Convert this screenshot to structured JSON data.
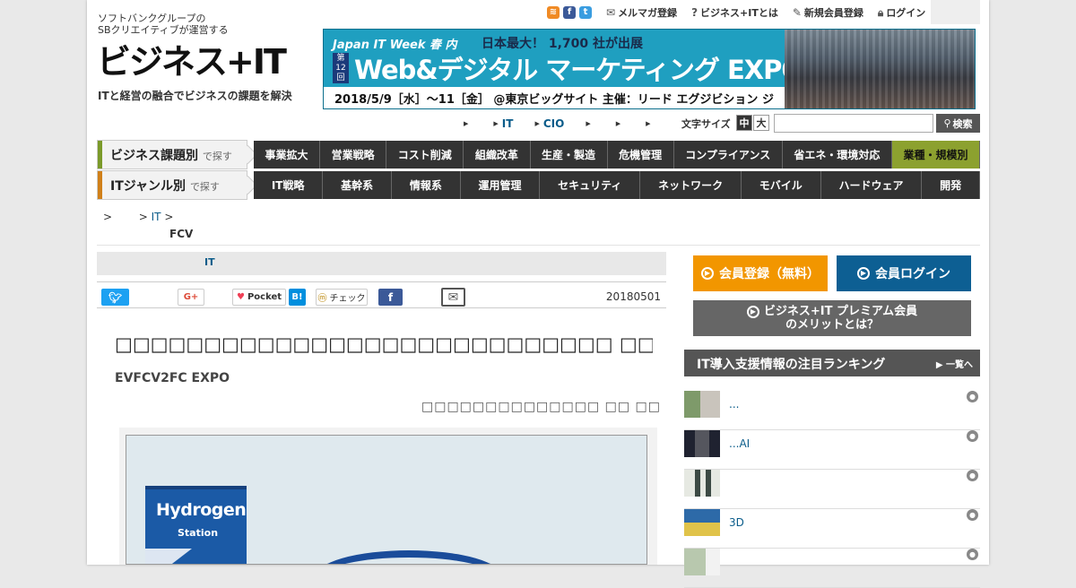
{
  "header": {
    "operator_line1": "ソフトバンクグループの",
    "operator_line2": "SBクリエイティブが運営する",
    "logo": "ビジネス+IT",
    "tagline": "ITと経営の融合でビジネスの課題を解決",
    "links": [
      {
        "label": "メルマガ登録",
        "icon": "envelope-icon"
      },
      {
        "label": "ビジネス+ITとは",
        "icon": "question-icon"
      },
      {
        "label": "新規会員登録",
        "icon": "pencil-icon"
      },
      {
        "label": "ログイン",
        "icon": "lock-icon"
      }
    ],
    "social_icons": [
      "rss-icon",
      "facebook-icon",
      "twitter-icon"
    ]
  },
  "banner": {
    "event_brand": "Japan IT Week 春 内",
    "headline": "日本最大！ 1,700 社が出展",
    "edition_line1": "第",
    "edition_line2": "12",
    "edition_line3": "回",
    "title": "Web&デジタル マーケティング EXPO 春",
    "info": "2018/5/9［水］～11［金］ @東京ビッグサイト 主催：リード エグジビション ジャパン（株）"
  },
  "util": {
    "items": [
      "",
      "IT",
      "CIO",
      "",
      "",
      ""
    ],
    "fontsize_label": "文字サイズ",
    "fontsize_medium": "中",
    "fontsize_large": "大",
    "search_placeholder": "",
    "search_button": "検索"
  },
  "nav": {
    "business_label": "ビジネス課題別",
    "business_suffix": "で探す",
    "business_items": [
      "事業拡大",
      "営業戦略",
      "コスト削減",
      "組織改革",
      "生産・製造",
      "危機管理",
      "コンプライアンス",
      "省エネ・環境対応",
      "業種・規模別"
    ],
    "it_label": "ITジャンル別",
    "it_suffix": "で探す",
    "it_items": [
      "IT戦略",
      "基幹系",
      "情報系",
      "運用管理",
      "セキュリティ",
      "ネットワーク",
      "モバイル",
      "ハードウェア",
      "開発"
    ]
  },
  "breadcrumb": {
    "sep1": ">",
    "link": "IT",
    "sep2": ">",
    "current": "FCV"
  },
  "article": {
    "category": "IT",
    "share": {
      "pocket": "Pocket",
      "hatena": "B!",
      "check": "チェック"
    },
    "date": "20180501",
    "title": "□□□□□□□□□□□□□□□□□□□□□□□□□□□□ □□□□□□□□□□FCV□□□□",
    "subtitle": "EVFCV2FC EXPO",
    "author": "□□□□□□□□□□□□□□ □□ □□",
    "figure": {
      "sign_line1": "Hydrogen",
      "sign_line2": "Station"
    }
  },
  "sidebar": {
    "register_button": "会員登録（無料）",
    "login_button": "会員ログイン",
    "premium_line1": "ビジネス+IT プレミアム会員",
    "premium_line2": "のメリットとは？",
    "ranking_title": "IT導入支援情報の注目ランキング",
    "ranking_more": "一覧へ",
    "ranking_items": [
      {
        "text": "...",
        "thumb": "#9aa48c"
      },
      {
        "text": "...AI",
        "thumb": "#2a2a3a"
      },
      {
        "text": "",
        "thumb": "#d6dcd2"
      },
      {
        "text": "3D",
        "thumb": "#3a6a9a"
      },
      {
        "text": "",
        "thumb": "#c8d2c0"
      }
    ]
  },
  "colors": {
    "accent_blue": "#0a5c8a",
    "register_orange": "#f29600",
    "login_blue": "#0d5f93",
    "nav_dark": "#333333",
    "nav_highlight": "#8ca12f"
  }
}
